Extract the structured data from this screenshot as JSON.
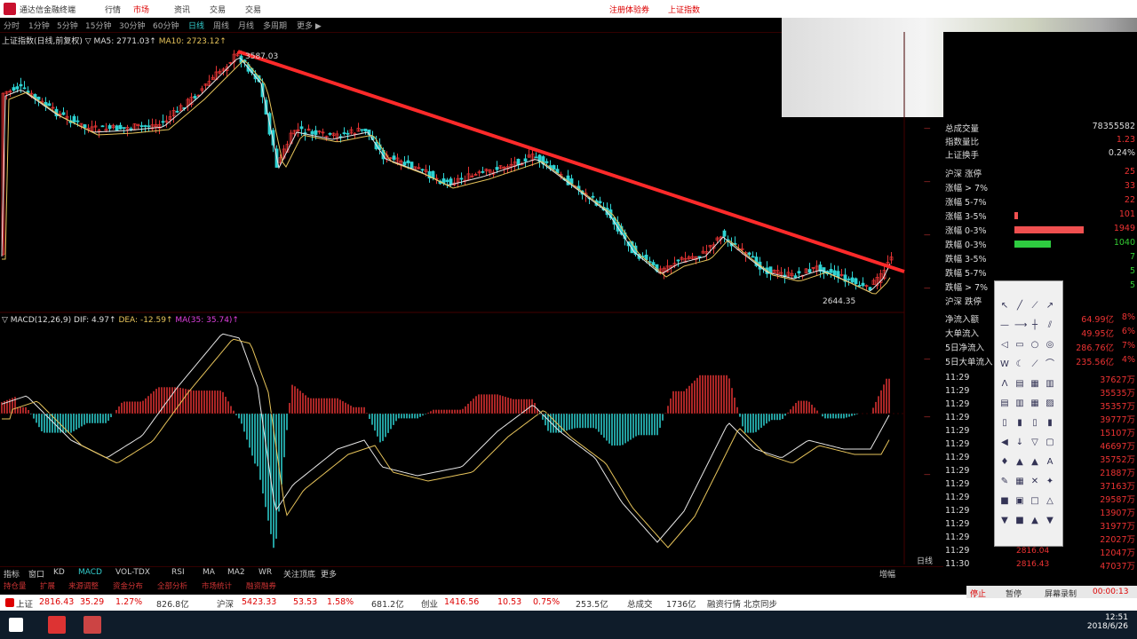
{
  "menubar": {
    "app_title": "通达信金融终端",
    "items": [
      "行情",
      "市场",
      "资讯",
      "交易",
      "交易"
    ],
    "active_index": 1,
    "promo1": "注册体验券",
    "promo2": "上证指数"
  },
  "periods": [
    "分时",
    "1分钟",
    "5分钟",
    "15分钟",
    "30分钟",
    "60分钟",
    "日线",
    "周线",
    "月线",
    "多周期",
    "更多 ▶"
  ],
  "active_period": "日线",
  "chart_legend": {
    "name": "上证指数(日线,前复权)",
    "ma5": "▽ MA5: 2771.03↑",
    "ma10": "MA10: 2723.12↑",
    "high_label": "3587.03",
    "low_label": "2644.35"
  },
  "macd_legend": {
    "name": "▽ MACD(12,26,9)",
    "dif": "DIF: 4.97↑",
    "dea": "DEA: -12.59↑",
    "ma": "MA(35: 35.74)↑"
  },
  "bottom_tabs": [
    "指标",
    "窗口",
    "KD",
    "MACD",
    "VOL-TDX",
    "RSI",
    "MA",
    "MA2",
    "WR",
    "关注顶底",
    "更多"
  ],
  "active_tab": "MACD",
  "bottom_tabs2": [
    "持仓量",
    "扩展",
    "来源调整",
    "资金分布",
    "全部分析",
    "市场统计",
    "融资融券"
  ],
  "right_panel": {
    "summary": [
      {
        "label": "总成交量",
        "value": "78355582",
        "color": "w"
      },
      {
        "label": "指数量比",
        "value": "1.23",
        "color": "r"
      },
      {
        "label": "上证换手",
        "value": "0.24%",
        "color": "w"
      }
    ],
    "distribution": [
      {
        "label": "沪深 涨停",
        "value": "25",
        "bar": 0,
        "color": "r"
      },
      {
        "label": "涨幅 > 7%",
        "value": "33",
        "bar": 0,
        "color": "r"
      },
      {
        "label": "涨幅 5-7%",
        "value": "22",
        "bar": 0,
        "color": "r"
      },
      {
        "label": "涨幅 3-5%",
        "value": "101",
        "bar": 0.05,
        "color": "r"
      },
      {
        "label": "涨幅 0-3%",
        "value": "1949",
        "bar": 1.0,
        "color": "r"
      },
      {
        "label": "跌幅 0-3%",
        "value": "1040",
        "bar": 0.53,
        "color": "g"
      },
      {
        "label": "跌幅 3-5%",
        "value": "7",
        "bar": 0,
        "color": "g"
      },
      {
        "label": "跌幅 5-7%",
        "value": "5",
        "bar": 0,
        "color": "g"
      },
      {
        "label": "跌幅 > 7%",
        "value": "5",
        "bar": 0,
        "color": "g"
      },
      {
        "label": "沪深 跌停",
        "value": "",
        "bar": 0,
        "color": "g"
      }
    ],
    "flows": [
      {
        "label": "净流入额",
        "value": "64.99亿",
        "pct": "8%"
      },
      {
        "label": "大单流入",
        "value": "49.95亿",
        "pct": "6%"
      },
      {
        "label": "5日净流入",
        "value": "286.76亿",
        "pct": "7%"
      },
      {
        "label": "5日大单流入",
        "value": "235.56亿",
        "pct": "4%"
      }
    ],
    "ticks": [
      {
        "time": "11:29",
        "value": "37627万"
      },
      {
        "time": "11:29",
        "value": "35535万"
      },
      {
        "time": "11:29",
        "value": "35357万"
      },
      {
        "time": "11:29",
        "value": "39777万"
      },
      {
        "time": "11:29",
        "value": "15107万"
      },
      {
        "time": "11:29",
        "value": "46697万"
      },
      {
        "time": "11:29",
        "value": "35752万"
      },
      {
        "time": "11:29",
        "value": "21887万"
      },
      {
        "time": "11:29",
        "value": "37163万"
      },
      {
        "time": "11:29",
        "value": "29587万"
      },
      {
        "time": "11:29",
        "value": "13907万"
      },
      {
        "time": "11:29",
        "value": "31977万"
      },
      {
        "time": "11:29",
        "value": "22027万"
      },
      {
        "time": "11:29",
        "value": "12047万"
      },
      {
        "time": "11:30",
        "value": "47037万"
      }
    ],
    "last_prices": [
      "2816.04",
      "2816.43"
    ]
  },
  "ticker": {
    "sh_label": "上证",
    "sh_price": "2816.43",
    "sh_change": "35.29",
    "sh_pct": "1.27%",
    "sh_amount": "826.8亿",
    "hs_label": "沪深",
    "hs_price": "5423.33",
    "hs_change": "53.53",
    "hs_pct": "1.58%",
    "hs_amount": "681.2亿",
    "cy_label": "创业",
    "cy_price": "1416.56",
    "cy_change": "10.53",
    "cy_pct": "0.75%",
    "cy_amount": "253.5亿",
    "extra1": "总成交",
    "extra2": "1736亿",
    "extra3": "融资行情 北京同步"
  },
  "buttons": {
    "stop": "停止",
    "pause": "暂停",
    "record": "屏幕录制",
    "timer": "00:00:13",
    "tab_right": "日线",
    "nav_right": "增幅"
  },
  "taskbar": {
    "time": "12:51",
    "date": "2018/6/26"
  },
  "colors": {
    "up": "#e33333",
    "down": "#2ed3d3",
    "trend": "#ff2a2a",
    "ma5": "#e6e6e6",
    "ma10": "#e6c35a"
  },
  "chart_data": {
    "type": "candlestick",
    "title": "上证指数(日线,前复权)",
    "trendline": {
      "from": "3587.03",
      "to": "2816.43",
      "color": "#ff2a2a"
    },
    "annotations": [
      "3587.03",
      "2644.35"
    ],
    "ma5_last": 2771.03,
    "ma10_last": 2723.12,
    "macd": {
      "dif": 4.97,
      "dea": -12.59
    }
  }
}
